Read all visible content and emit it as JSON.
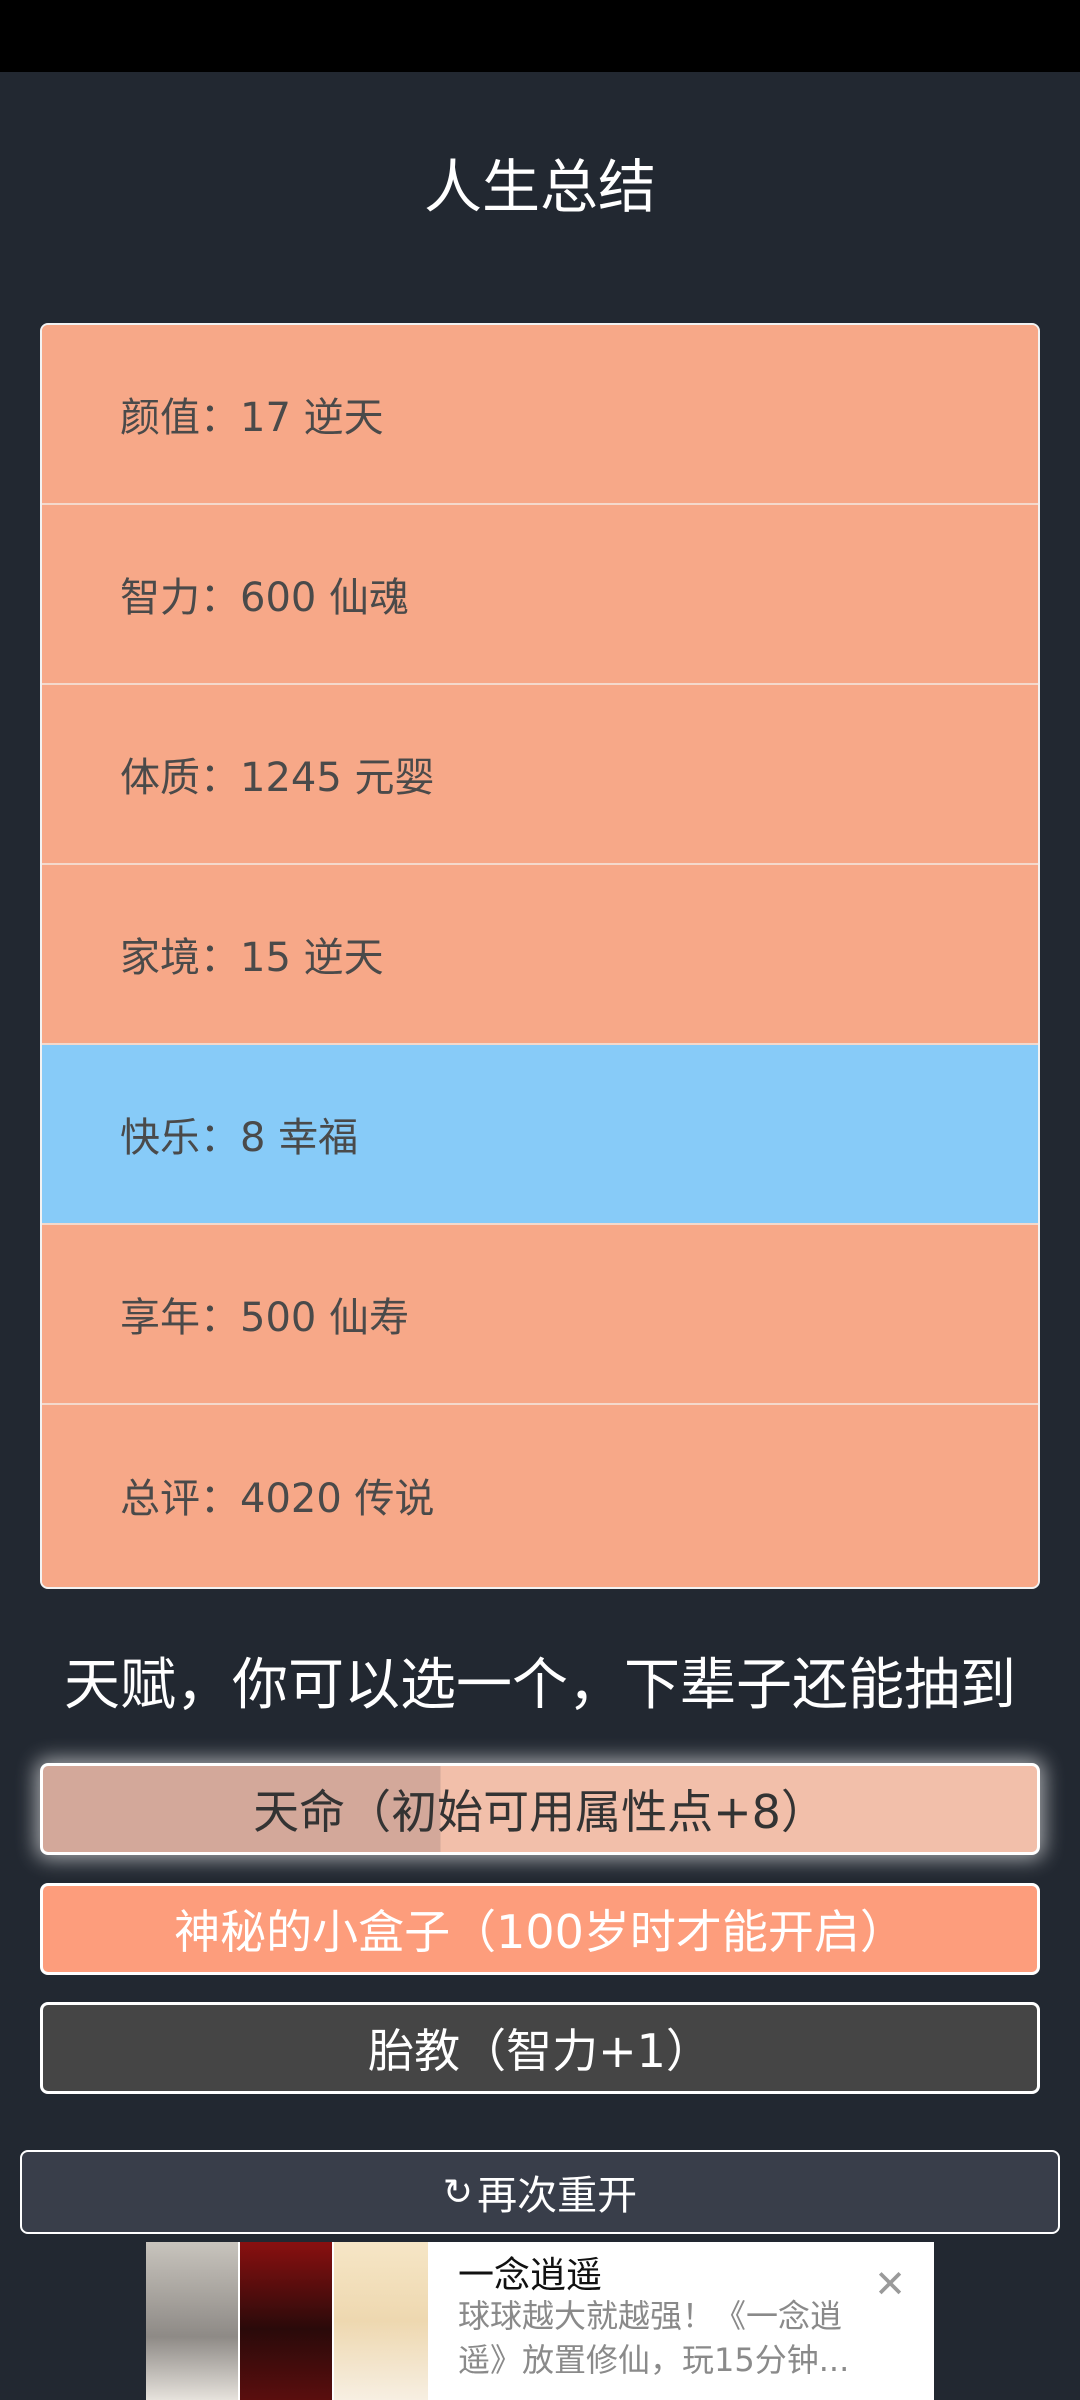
{
  "page": {
    "title": "人生总结"
  },
  "summary": {
    "rows": [
      {
        "text": "颜值：17 逆天",
        "color": "#f7a888"
      },
      {
        "text": "智力：600 仙魂",
        "color": "#f7a888"
      },
      {
        "text": "体质：1245 元婴",
        "color": "#f7a888"
      },
      {
        "text": "家境：15 逆天",
        "color": "#f7a888"
      },
      {
        "text": "快乐：8 幸福",
        "color": "#87cbf8"
      },
      {
        "text": "享年：500 仙寿",
        "color": "#f7a888"
      },
      {
        "text": "总评：4020 传说",
        "color": "#f7a888"
      }
    ]
  },
  "talents": {
    "heading": "天赋，你可以选一个，下辈子还能抽到",
    "options": [
      {
        "label": "天命（初始可用属性点+8）"
      },
      {
        "label": "神秘的小盒子（100岁时才能开启）"
      },
      {
        "label": "胎教（智力+1）"
      }
    ]
  },
  "restart": {
    "icon": "refresh-icon",
    "label": "再次重开"
  },
  "ad": {
    "title": "一念逍遥",
    "description": "球球越大就越强！《一念逍遥》放置修仙，玩15分钟...",
    "close_icon": "close-icon"
  }
}
